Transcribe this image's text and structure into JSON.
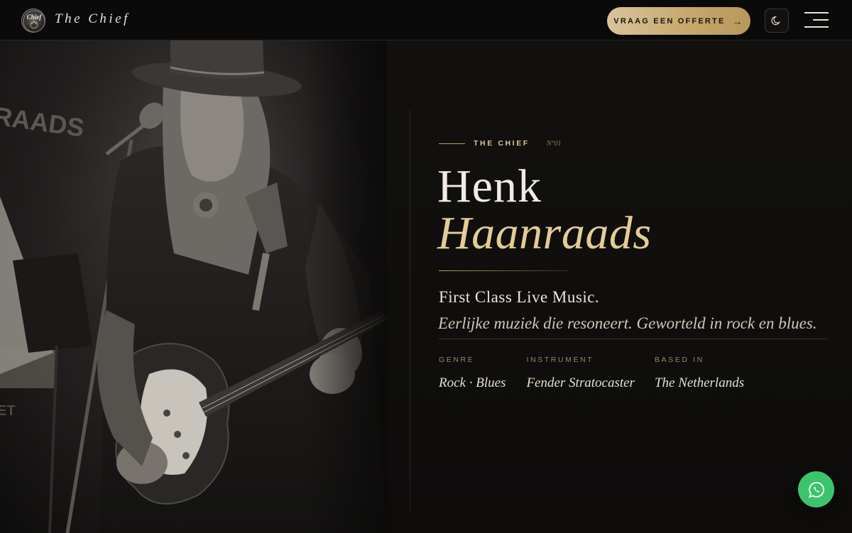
{
  "header": {
    "brand": "The Chief",
    "logo_text": "Chief",
    "quote_button": "VRAAG EEN OFFERTE",
    "quote_arrow": "→",
    "theme_icon": "moon-icon",
    "menu_icon": "hamburger-menu-icon"
  },
  "photo": {
    "backdrop_text_top": "RAADS",
    "backdrop_text_bottom": "ET"
  },
  "hero": {
    "eyebrow": "THE CHIEF",
    "number": "N°01",
    "first_name": "Henk",
    "last_name": "Haanraads",
    "tagline": "First Class Live Music.",
    "subline": "Eerlijke muziek die resoneert. Geworteld in rock en blues.",
    "facts": [
      {
        "label": "GENRE",
        "value": "Rock · Blues"
      },
      {
        "label": "INSTRUMENT",
        "value": "Fender Stratocaster"
      },
      {
        "label": "BASED IN",
        "value": "The Netherlands"
      }
    ]
  },
  "whatsapp": {
    "icon": "whatsapp-icon"
  },
  "colors": {
    "accent_gold": "#e3cc97",
    "button_gold": "#c7a86e",
    "background": "#0b0a09",
    "whatsapp_green": "#3cc46a"
  }
}
